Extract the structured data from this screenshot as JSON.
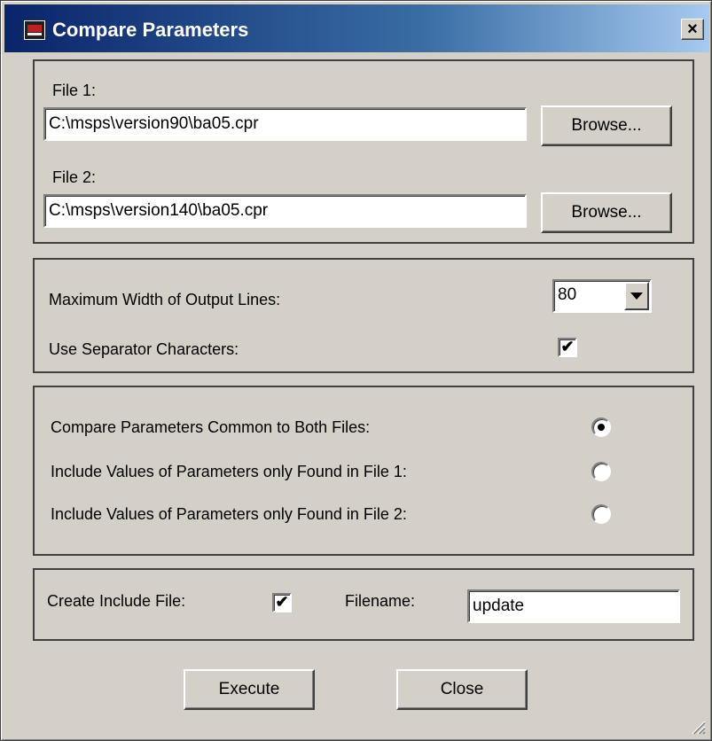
{
  "window": {
    "title": "Compare Parameters",
    "close_symbol": "×"
  },
  "files": {
    "file1_label": "File 1:",
    "file1_value": "C:\\msps\\version90\\ba05.cpr",
    "file2_label": "File 2:",
    "file2_value": "C:\\msps\\version140\\ba05.cpr",
    "browse_label": "Browse..."
  },
  "output": {
    "max_width_label": "Maximum Width of Output Lines:",
    "max_width_value": "80",
    "separator_label": "Use Separator Characters:",
    "separator_checked": true,
    "check_glyph": "✔"
  },
  "compare_mode": {
    "options": [
      {
        "label": "Compare Parameters Common to Both Files:",
        "selected": true
      },
      {
        "label": "Include Values of Parameters only Found in File 1:",
        "selected": false
      },
      {
        "label": "Include Values of Parameters only Found in File 2:",
        "selected": false
      }
    ]
  },
  "include_file": {
    "create_label": "Create Include File:",
    "create_checked": true,
    "filename_label": "Filename:",
    "filename_value": "update"
  },
  "actions": {
    "execute_label": "Execute",
    "close_label": "Close"
  },
  "icons": {
    "app": "app-icon",
    "close": "close-icon",
    "dropdown": "chevron-down-icon",
    "resize": "resize-grip-icon"
  },
  "colors": {
    "face": "#d4d0c8",
    "title_start": "#0a246a",
    "title_end": "#a6caf0"
  }
}
